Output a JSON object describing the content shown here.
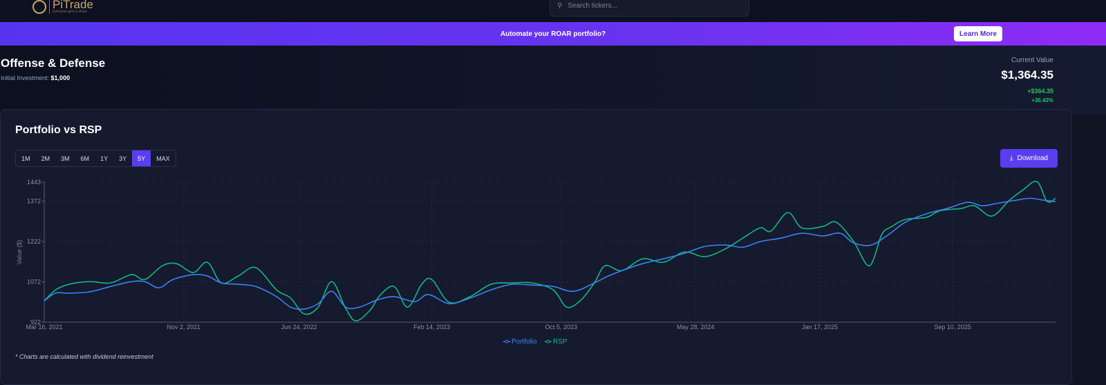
{
  "nav": {
    "brand": "PiTrade",
    "tagline": "Everyone gets a share",
    "search_placeholder": "Search tickers..."
  },
  "banner": {
    "text": "Automate your ROAR portfolio?",
    "button": "Learn More"
  },
  "portfolio": {
    "title": "Offense & Defense",
    "initial_label": "Initial Investment:",
    "initial_value": "$1,000",
    "current_label": "Current Value",
    "current_value": "$1,364.35",
    "gain": "+$364.35",
    "gain_pct": "+36.43%"
  },
  "card": {
    "title": "Portfolio vs RSP",
    "ranges": [
      "1M",
      "2M",
      "3M",
      "6M",
      "1Y",
      "3Y",
      "5Y",
      "MAX"
    ],
    "active_range": "5Y",
    "download": "Download",
    "note": "* Charts are calculated with dividend reinvestment"
  },
  "colors": {
    "portfolio": "#3b82f6",
    "rsp": "#10b981",
    "accent": "#5b3df0"
  },
  "chart_data": {
    "type": "line",
    "title": "Portfolio vs RSP",
    "xlabel": "",
    "ylabel": "Value ($)",
    "ylim": [
      922,
      1443
    ],
    "yticks": [
      922,
      1072,
      1222,
      1372,
      1443
    ],
    "xlim_days": [
      0,
      1798
    ],
    "xticks": [
      {
        "day": 0,
        "label": "Mar 16, 2021"
      },
      {
        "day": 248,
        "label": "Nov 2, 2021"
      },
      {
        "day": 453,
        "label": "Jun 24, 2022"
      },
      {
        "day": 689,
        "label": "Feb 14, 2023"
      },
      {
        "day": 919,
        "label": "Oct 5, 2023"
      },
      {
        "day": 1158,
        "label": "May 28, 2024"
      },
      {
        "day": 1379,
        "label": "Jan 17, 2025"
      },
      {
        "day": 1615,
        "label": "Sep 10, 2025"
      }
    ],
    "legend": "bottom",
    "series": [
      {
        "name": "Portfolio",
        "points": [
          [
            0,
            1001
          ],
          [
            20,
            1030
          ],
          [
            44,
            1030
          ],
          [
            81,
            1035
          ],
          [
            118,
            1055
          ],
          [
            155,
            1073
          ],
          [
            179,
            1073
          ],
          [
            204,
            1050
          ],
          [
            229,
            1081
          ],
          [
            265,
            1099
          ],
          [
            290,
            1094
          ],
          [
            315,
            1068
          ],
          [
            345,
            1063
          ],
          [
            376,
            1055
          ],
          [
            413,
            1017
          ],
          [
            438,
            978
          ],
          [
            462,
            971
          ],
          [
            487,
            991
          ],
          [
            511,
            1037
          ],
          [
            536,
            978
          ],
          [
            560,
            978
          ],
          [
            591,
            1004
          ],
          [
            622,
            1017
          ],
          [
            659,
            999
          ],
          [
            683,
            1025
          ],
          [
            720,
            991
          ],
          [
            757,
            1012
          ],
          [
            794,
            1042
          ],
          [
            831,
            1063
          ],
          [
            868,
            1060
          ],
          [
            905,
            1055
          ],
          [
            941,
            1037
          ],
          [
            978,
            1068
          ],
          [
            1003,
            1094
          ],
          [
            1027,
            1114
          ],
          [
            1064,
            1140
          ],
          [
            1101,
            1158
          ],
          [
            1138,
            1178
          ],
          [
            1175,
            1204
          ],
          [
            1212,
            1209
          ],
          [
            1242,
            1201
          ],
          [
            1273,
            1222
          ],
          [
            1310,
            1235
          ],
          [
            1347,
            1253
          ],
          [
            1384,
            1243
          ],
          [
            1415,
            1253
          ],
          [
            1439,
            1217
          ],
          [
            1470,
            1209
          ],
          [
            1501,
            1248
          ],
          [
            1531,
            1294
          ],
          [
            1568,
            1325
          ],
          [
            1605,
            1345
          ],
          [
            1642,
            1368
          ],
          [
            1667,
            1355
          ],
          [
            1691,
            1363
          ],
          [
            1728,
            1376
          ],
          [
            1753,
            1383
          ],
          [
            1777,
            1376
          ],
          [
            1798,
            1371
          ]
        ]
      },
      {
        "name": "RSP",
        "points": [
          [
            0,
            1001
          ],
          [
            20,
            1042
          ],
          [
            44,
            1063
          ],
          [
            81,
            1073
          ],
          [
            118,
            1068
          ],
          [
            155,
            1099
          ],
          [
            179,
            1081
          ],
          [
            210,
            1132
          ],
          [
            235,
            1140
          ],
          [
            265,
            1107
          ],
          [
            290,
            1145
          ],
          [
            315,
            1068
          ],
          [
            345,
            1094
          ],
          [
            376,
            1125
          ],
          [
            413,
            1042
          ],
          [
            438,
            1012
          ],
          [
            462,
            953
          ],
          [
            487,
            978
          ],
          [
            511,
            1073
          ],
          [
            536,
            973
          ],
          [
            554,
            927
          ],
          [
            579,
            966
          ],
          [
            597,
            1022
          ],
          [
            622,
            1055
          ],
          [
            646,
            978
          ],
          [
            671,
            1063
          ],
          [
            689,
            1081
          ],
          [
            720,
            996
          ],
          [
            757,
            1017
          ],
          [
            794,
            1063
          ],
          [
            831,
            1068
          ],
          [
            868,
            1068
          ],
          [
            905,
            1042
          ],
          [
            929,
            978
          ],
          [
            954,
            1004
          ],
          [
            978,
            1068
          ],
          [
            997,
            1132
          ],
          [
            1027,
            1114
          ],
          [
            1064,
            1158
          ],
          [
            1101,
            1145
          ],
          [
            1138,
            1183
          ],
          [
            1175,
            1166
          ],
          [
            1212,
            1196
          ],
          [
            1242,
            1235
          ],
          [
            1273,
            1273
          ],
          [
            1292,
            1261
          ],
          [
            1322,
            1330
          ],
          [
            1347,
            1273
          ],
          [
            1384,
            1278
          ],
          [
            1408,
            1294
          ],
          [
            1439,
            1222
          ],
          [
            1467,
            1132
          ],
          [
            1489,
            1248
          ],
          [
            1507,
            1278
          ],
          [
            1531,
            1304
          ],
          [
            1568,
            1312
          ],
          [
            1593,
            1337
          ],
          [
            1630,
            1345
          ],
          [
            1654,
            1355
          ],
          [
            1685,
            1317
          ],
          [
            1716,
            1376
          ],
          [
            1740,
            1414
          ],
          [
            1765,
            1445
          ],
          [
            1783,
            1371
          ],
          [
            1798,
            1383
          ]
        ]
      }
    ]
  }
}
